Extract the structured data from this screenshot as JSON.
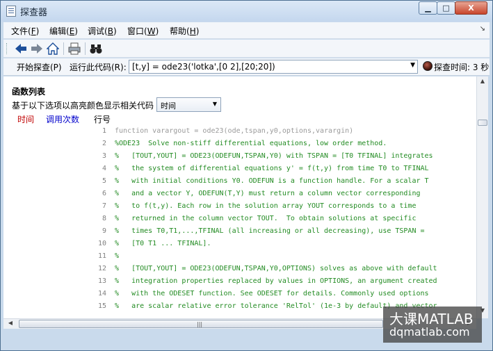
{
  "window": {
    "title": "探查器"
  },
  "titlebar_buttons": {
    "minimize": "▁",
    "maximize": "□",
    "close": "X"
  },
  "menu": [
    {
      "text": "文件",
      "key": "F"
    },
    {
      "text": "编辑",
      "key": "E"
    },
    {
      "text": "调试",
      "key": "B"
    },
    {
      "text": "窗口",
      "key": "W"
    },
    {
      "text": "帮助",
      "key": "H"
    }
  ],
  "menu_corner": "↘",
  "toolbar": {
    "icons": [
      "back-arrow-icon",
      "forward-arrow-icon",
      "home-icon",
      "print-icon",
      "find-binoculars-icon"
    ]
  },
  "runbar": {
    "start_label": "开始探查(P)",
    "run_code_label": "运行此代码(R):",
    "command": "[t,y] = ode23('lotka',[0 2],[20;20])",
    "time_label": "探查时间: 3 秒"
  },
  "function_list": {
    "title": "函数列表",
    "highlight_label": "基于以下选项以高亮颜色显示相关代码",
    "highlight_selected": "时间",
    "columns": {
      "time": "时间",
      "calls": "调用次数",
      "line": "行号"
    }
  },
  "code_lines": [
    {
      "n": "1",
      "kind": "func",
      "text": "function varargout = ode23(ode,tspan,y0,options,varargin)"
    },
    {
      "n": "2",
      "kind": "comment",
      "text": "%ODE23  Solve non-stiff differential equations, low order method."
    },
    {
      "n": "3",
      "kind": "comment",
      "text": "%   [TOUT,YOUT] = ODE23(ODEFUN,TSPAN,Y0) with TSPAN = [T0 TFINAL] integrates"
    },
    {
      "n": "4",
      "kind": "comment",
      "text": "%   the system of differential equations y' = f(t,y) from time T0 to TFINAL"
    },
    {
      "n": "5",
      "kind": "comment",
      "text": "%   with initial conditions Y0. ODEFUN is a function handle. For a scalar T"
    },
    {
      "n": "6",
      "kind": "comment",
      "text": "%   and a vector Y, ODEFUN(T,Y) must return a column vector corresponding"
    },
    {
      "n": "7",
      "kind": "comment",
      "text": "%   to f(t,y). Each row in the solution array YOUT corresponds to a time"
    },
    {
      "n": "8",
      "kind": "comment",
      "text": "%   returned in the column vector TOUT.  To obtain solutions at specific"
    },
    {
      "n": "9",
      "kind": "comment",
      "text": "%   times T0,T1,...,TFINAL (all increasing or all decreasing), use TSPAN ="
    },
    {
      "n": "10",
      "kind": "comment",
      "text": "%   [T0 T1 ... TFINAL]."
    },
    {
      "n": "11",
      "kind": "comment",
      "text": "%"
    },
    {
      "n": "12",
      "kind": "comment",
      "text": "%   [TOUT,YOUT] = ODE23(ODEFUN,TSPAN,Y0,OPTIONS) solves as above with default"
    },
    {
      "n": "13",
      "kind": "comment",
      "text": "%   integration properties replaced by values in OPTIONS, an argument created"
    },
    {
      "n": "14",
      "kind": "comment",
      "text": "%   with the ODESET function. See ODESET for details. Commonly used options"
    },
    {
      "n": "15",
      "kind": "comment",
      "text": "%   are scalar relative error tolerance 'RelTol' (1e-3 by default) and vector"
    }
  ],
  "scroll": {
    "up": "▲",
    "down": "▼",
    "left": "◀",
    "right": "▶",
    "grip": "|||"
  },
  "watermark": {
    "line1": "大课MATLAB",
    "line2": "dqmatlab.com"
  },
  "colors": {
    "time_header": "#c00000",
    "calls_header": "#0000cc",
    "comment": "#228b22",
    "func_line": "#9a9a9a"
  }
}
